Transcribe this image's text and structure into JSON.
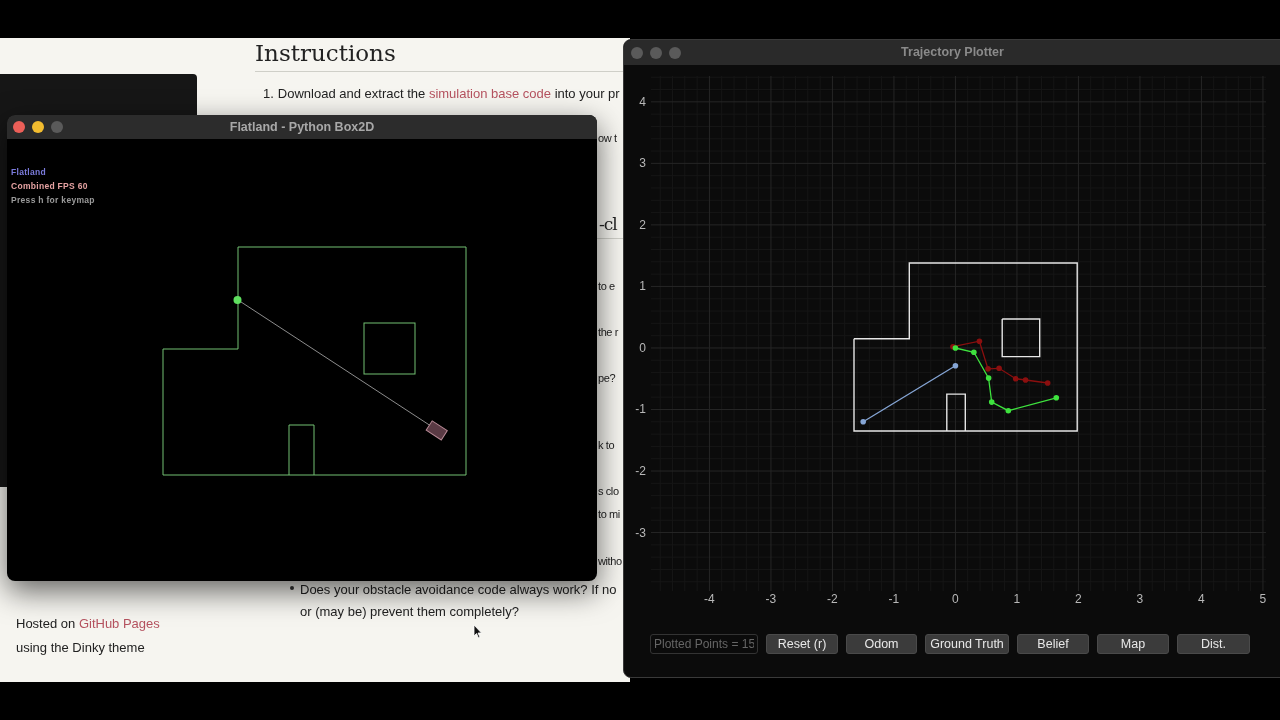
{
  "browser_page": {
    "heading": "Instructions",
    "step_1": {
      "number": "1.",
      "before": "Download and extract the",
      "link": "simulation base code",
      "after": "into your pr"
    },
    "fragments": [
      {
        "kind": "text",
        "text": "ow t"
      },
      {
        "kind": "heading",
        "text": "-cl"
      },
      {
        "kind": "text",
        "text": "to e"
      },
      {
        "kind": "text",
        "text": "the r"
      },
      {
        "kind": "text",
        "text": "pe?"
      },
      {
        "kind": "text",
        "text": "k to"
      },
      {
        "kind": "text",
        "text": "s clo"
      },
      {
        "kind": "text",
        "text": "to mi"
      },
      {
        "kind": "text",
        "text": "witho"
      }
    ],
    "bullet_lines": [
      "Does your obstacle avoidance code always work? If no",
      "or (may be) prevent them completely?"
    ],
    "footer": {
      "before": "Hosted on",
      "link": "GitHub Pages",
      "line_2": "using the Dinky theme"
    }
  },
  "flatland_window": {
    "title": "Flatland - Python Box2D",
    "hud": [
      {
        "text": "Flatland",
        "color": "#7b7bdc"
      },
      {
        "text": "Combined FPS 60",
        "color": "#e4a1a1"
      },
      {
        "text": "Press h for keymap",
        "color": "#9a9a9a"
      }
    ]
  },
  "plotter_window": {
    "title": "Trajectory Plotter",
    "x_tick_labels": [
      "-4",
      "-3",
      "-2",
      "-1",
      "0",
      "1",
      "2",
      "3",
      "4",
      "5"
    ],
    "y_tick_labels": [
      "4",
      "3",
      "2",
      "1",
      "0",
      "-1",
      "-2",
      "-3"
    ],
    "points_field": {
      "value": "Plotted Points = 15"
    },
    "buttons": [
      "Reset (r)",
      "Odom",
      "Ground Truth",
      "Belief",
      "Map",
      "Dist."
    ]
  }
}
